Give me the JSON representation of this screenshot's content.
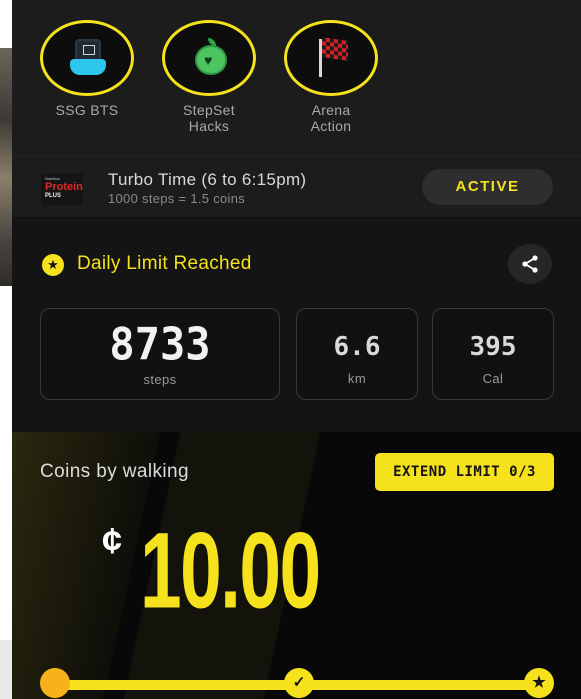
{
  "shortcuts": [
    {
      "label": "SSG BTS",
      "icon": "ssg-bts-icon"
    },
    {
      "label": "StepSet\nHacks",
      "icon": "apple-heart-icon"
    },
    {
      "label": "Arena\nAction",
      "icon": "checkered-flag-icon"
    }
  ],
  "turbo": {
    "logo_small": "Nutrition",
    "logo_brand": "Protein",
    "logo_sub": "PLUS",
    "title": "Turbo Time (6 to 6:15pm)",
    "subtitle": "1000 steps = 1.5 coins",
    "status": "ACTIVE"
  },
  "daily_limit": {
    "icon": "star-icon",
    "text": "Daily Limit Reached",
    "share_icon": "share-icon"
  },
  "stats": {
    "steps": {
      "value": "8733",
      "unit": "steps"
    },
    "distance": {
      "value": "6.6",
      "unit": "km"
    },
    "calories": {
      "value": "395",
      "unit": "Cal"
    }
  },
  "coins": {
    "label": "Coins by walking",
    "extend_label": "EXTEND LIMIT 0/3",
    "currency_symbol": "¢",
    "amount": "10.00",
    "progress_fraction": 1.0
  },
  "colors": {
    "accent": "#f5e11c",
    "background": "#141414",
    "panel": "#1c1c1c"
  }
}
